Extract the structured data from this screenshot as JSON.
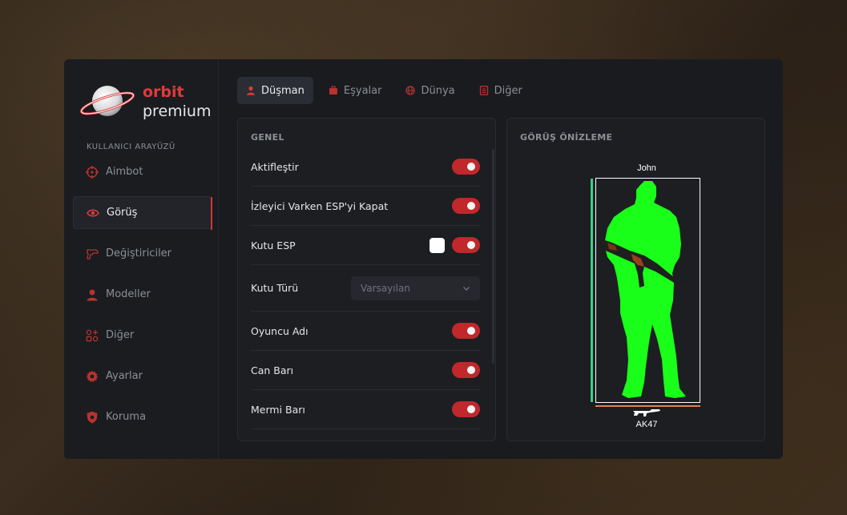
{
  "brand": {
    "name": "orbit",
    "tier": "premium",
    "accent_color": "#e03a3a"
  },
  "sidebar": {
    "section_label": "KULLANICI ARAYÜZÜ",
    "items": [
      {
        "label": "Aimbot",
        "icon": "crosshair-icon",
        "active": false
      },
      {
        "label": "Görüş",
        "icon": "eye-icon",
        "active": true
      },
      {
        "label": "Değiştiriciler",
        "icon": "gun-icon",
        "active": false
      },
      {
        "label": "Modeller",
        "icon": "user-icon",
        "active": false
      },
      {
        "label": "Diğer",
        "icon": "grid-plus-icon",
        "active": false
      },
      {
        "label": "Ayarlar",
        "icon": "gear-icon",
        "active": false
      },
      {
        "label": "Koruma",
        "icon": "shield-icon",
        "active": false
      }
    ]
  },
  "tabs": [
    {
      "label": "Düşman",
      "icon": "user-icon",
      "active": true
    },
    {
      "label": "Eşyalar",
      "icon": "box-icon",
      "active": false
    },
    {
      "label": "Dünya",
      "icon": "globe-icon",
      "active": false
    },
    {
      "label": "Diğer",
      "icon": "list-icon",
      "active": false
    }
  ],
  "general": {
    "title": "GENEL",
    "rows": [
      {
        "label": "Aktifleştir",
        "type": "toggle",
        "on": true
      },
      {
        "label": "İzleyici Varken ESP'yi Kapat",
        "type": "toggle",
        "on": true
      },
      {
        "label": "Kutu ESP",
        "type": "toggle-color",
        "on": true,
        "color": "#ffffff"
      },
      {
        "label": "Kutu Türü",
        "type": "select",
        "value": "Varsayılan"
      },
      {
        "label": "Oyuncu Adı",
        "type": "toggle",
        "on": true
      },
      {
        "label": "Can Barı",
        "type": "toggle",
        "on": true
      },
      {
        "label": "Mermi Barı",
        "type": "toggle",
        "on": true
      }
    ]
  },
  "preview": {
    "title": "GÖRÜŞ ÖNİZLEME",
    "player_name": "John",
    "weapon": "AK47",
    "silhouette_color": "#1aff1a",
    "health_color": "#3ccf86",
    "ammo_color": "#e0824a",
    "box_color": "#ffffff"
  }
}
